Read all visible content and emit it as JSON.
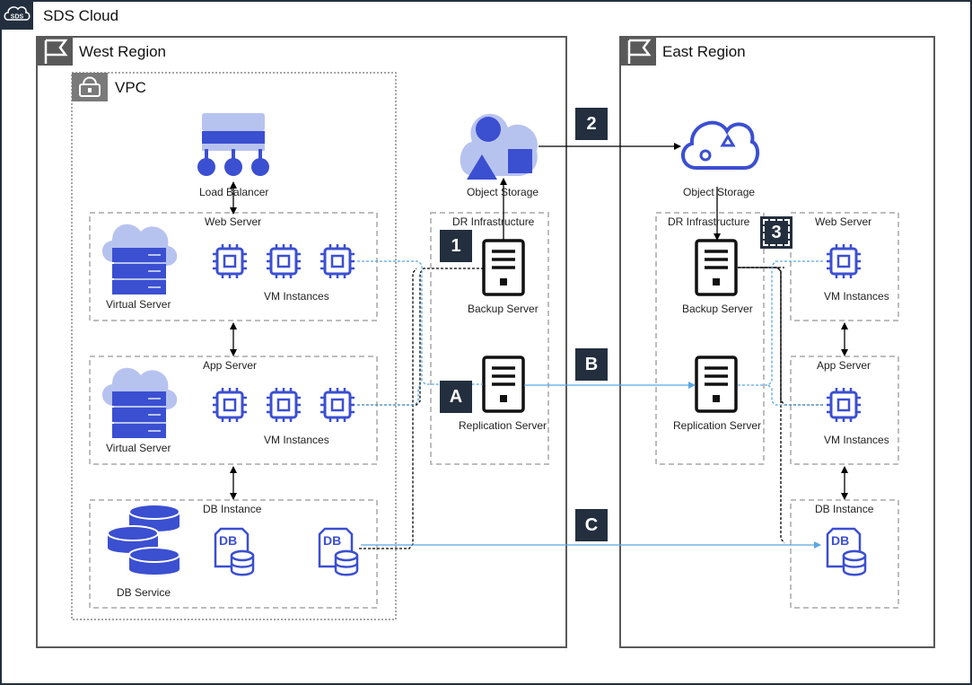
{
  "cloud": {
    "title": "SDS Cloud",
    "logo_text": "SDS"
  },
  "west": {
    "title": "West Region",
    "vpc": "VPC",
    "load_balancer": "Load Balancer",
    "web_server": {
      "title": "Web Server",
      "virtual_server": "Virtual Server",
      "vm_instances": "VM Instances"
    },
    "app_server": {
      "title": "App Server",
      "virtual_server": "Virtual Server",
      "vm_instances": "VM Instances"
    },
    "db_instance": {
      "title": "DB Instance",
      "db_service": "DB Service"
    },
    "object_storage": "Object Storage",
    "dr_infrastructure": "DR Infrastructure",
    "backup_server": "Backup Server",
    "replication_server": "Replication Server"
  },
  "east": {
    "title": "East Region",
    "object_storage": "Object Storage",
    "dr_infrastructure": "DR Infrastructure",
    "backup_server": "Backup Server",
    "replication_server": "Replication Server",
    "web_server": {
      "title": "Web Server",
      "vm_instances": "VM Instances"
    },
    "app_server": {
      "title": "App Server",
      "vm_instances": "VM Instances"
    },
    "db_instance": {
      "title": "DB Instance"
    }
  },
  "badges": {
    "b1": "1",
    "b2": "2",
    "b3": "3",
    "bA": "A",
    "bB": "B",
    "bC": "C"
  },
  "colors": {
    "icon_blue": "#3b4fd1",
    "light_blue": "#b7c3ef",
    "badge_dark": "#232f3e",
    "flow_light_blue": "#5aa7e0",
    "border_gray": "#595959",
    "dashed_gray": "#bdbdbd"
  }
}
